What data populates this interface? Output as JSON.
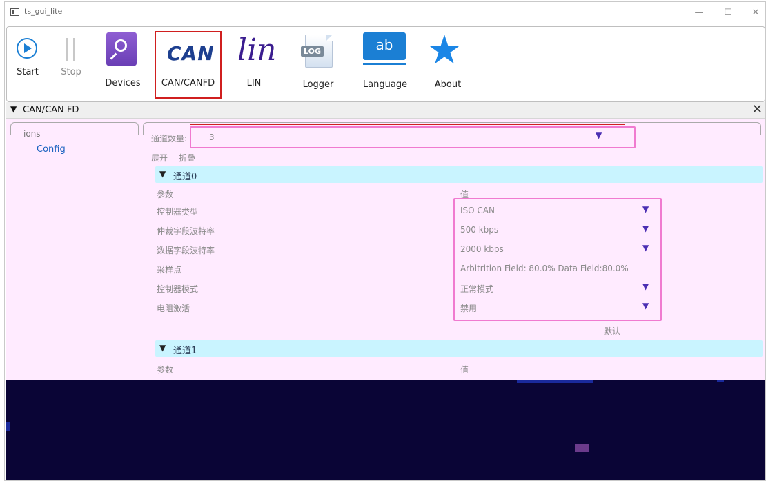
{
  "window": {
    "title": "ts_gui_lite",
    "controls": {
      "minimize": "—",
      "maximize": "☐",
      "close": "✕"
    }
  },
  "toolbar": {
    "start": {
      "label": "Start",
      "icon": "play-circle-icon"
    },
    "stop": {
      "label": "Stop",
      "icon": "pause-icon"
    },
    "devices": {
      "label": "Devices",
      "icon": "search-icon"
    },
    "can": {
      "label": "CAN/CANFD",
      "logo_text": "CAN",
      "icon": "can-logo-icon"
    },
    "lin": {
      "label": "LIN",
      "logo_text": "lin",
      "icon": "lin-logo-icon"
    },
    "logger": {
      "label": "Logger",
      "logo_text": "LOG",
      "icon": "log-document-icon"
    },
    "language": {
      "label": "Language",
      "logo_text": "ab",
      "icon": "language-icon"
    },
    "about": {
      "label": "About",
      "icon": "star-icon"
    }
  },
  "panel": {
    "arrow": "▼",
    "title": "CAN/CAN FD",
    "close": "✕"
  },
  "tree": {
    "title": "ions",
    "items": [
      "Config"
    ]
  },
  "config": {
    "channel_count_label": "通道数量:",
    "channel_count_value": "3",
    "expand": "展开",
    "collapse": "折叠",
    "groups": [
      {
        "title": "通道0",
        "param_header": "参数",
        "value_header": "值",
        "params": [
          {
            "name": "控制器类型",
            "value": "ISO CAN",
            "dropdown": true
          },
          {
            "name": "仲裁字段波特率",
            "value": "500 kbps",
            "dropdown": true
          },
          {
            "name": "数据字段波特率",
            "value": "2000 kbps",
            "dropdown": true
          },
          {
            "name": "采样点",
            "value": "Arbitrition Field: 80.0% Data Field:80.0%",
            "dropdown": false
          },
          {
            "name": "控制器模式",
            "value": "正常模式",
            "dropdown": true
          },
          {
            "name": "电阻激活",
            "value": "禁用",
            "dropdown": true
          }
        ],
        "default_button": "默认"
      },
      {
        "title": "通道1",
        "param_header": "参数",
        "value_header": "值"
      }
    ]
  },
  "colors": {
    "accent_blue": "#1b7fd4",
    "highlight_red": "#d01f1f",
    "highlight_pink": "#f07ad0",
    "content_bg": "#ffebff",
    "group_bar": "#c9f4ff"
  }
}
